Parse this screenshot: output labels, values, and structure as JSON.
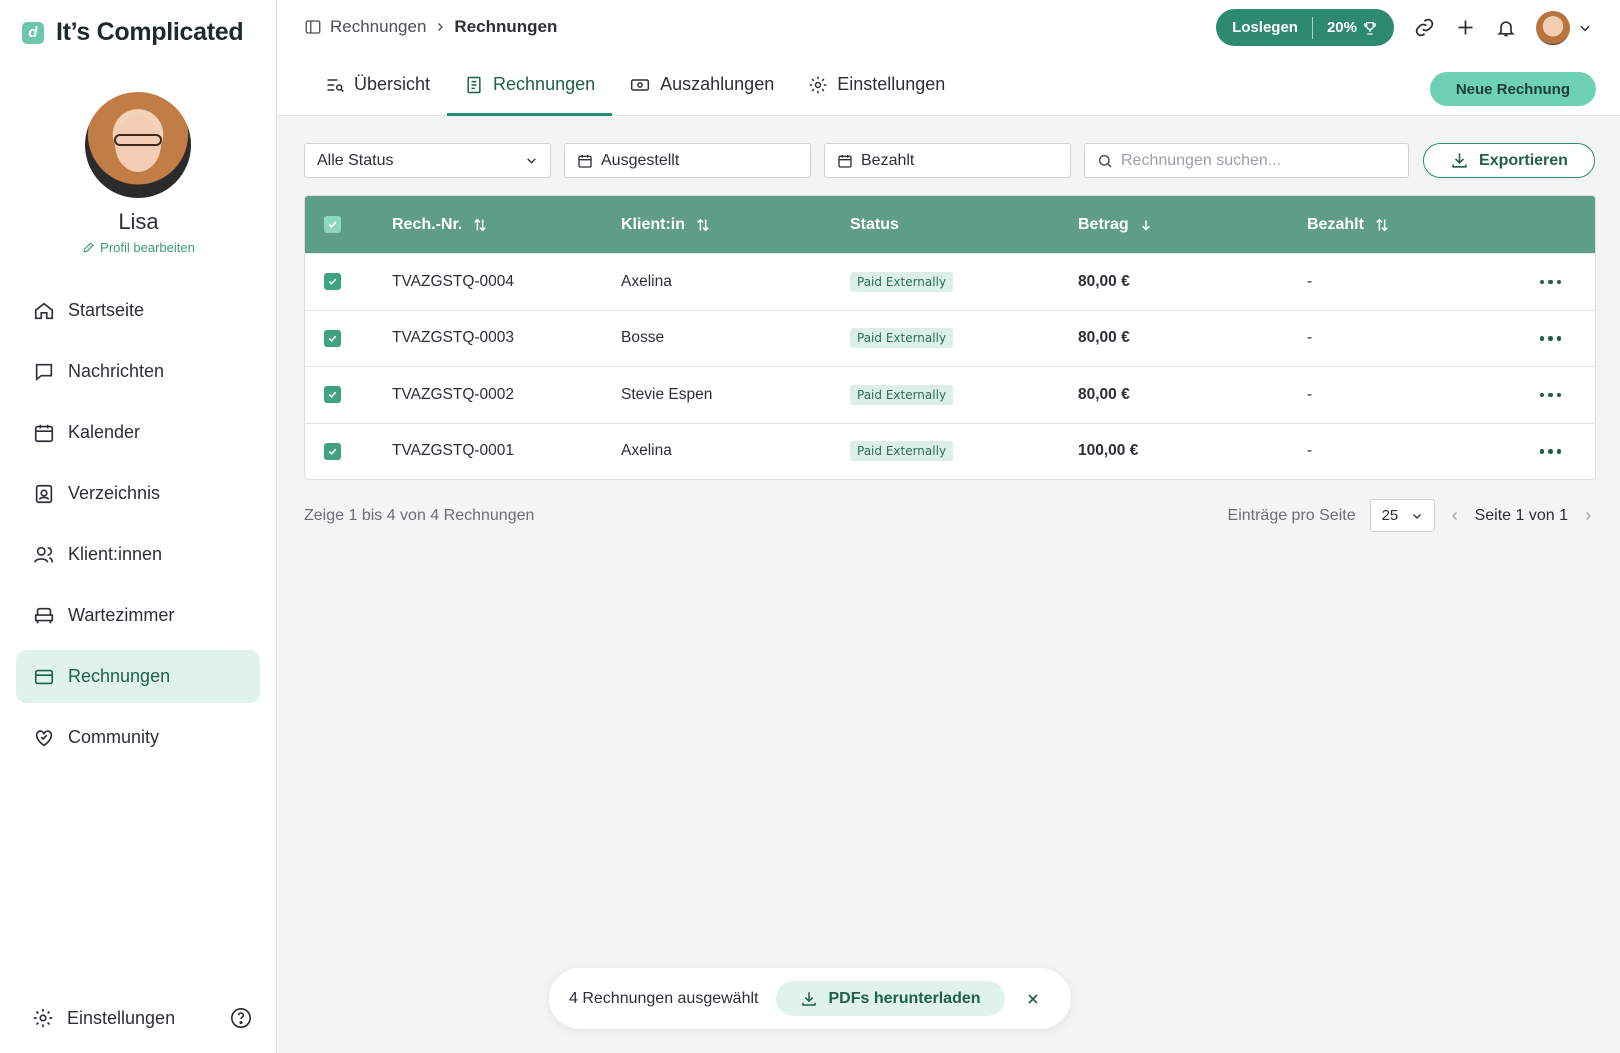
{
  "app": {
    "name": "It’s Complicated",
    "logo_letter": "d"
  },
  "profile": {
    "name": "Lisa",
    "edit_label": "Profil bearbeiten"
  },
  "sidebar": {
    "items": [
      {
        "label": "Startseite",
        "icon": "home-icon"
      },
      {
        "label": "Nachrichten",
        "icon": "message-icon"
      },
      {
        "label": "Kalender",
        "icon": "calendar-icon"
      },
      {
        "label": "Verzeichnis",
        "icon": "directory-icon"
      },
      {
        "label": "Klient:innen",
        "icon": "users-icon"
      },
      {
        "label": "Wartezimmer",
        "icon": "waiting-room-icon"
      },
      {
        "label": "Rechnungen",
        "icon": "invoice-card-icon",
        "active": true
      },
      {
        "label": "Community",
        "icon": "heart-handshake-icon"
      }
    ],
    "footer_settings": "Einstellungen"
  },
  "breadcrumb": {
    "parent": "Rechnungen",
    "current": "Rechnungen"
  },
  "topbar": {
    "start_label": "Loslegen",
    "progress": "20%"
  },
  "tabs": [
    {
      "label": "Übersicht",
      "icon": "overview-icon"
    },
    {
      "label": "Rechnungen",
      "icon": "document-icon",
      "active": true
    },
    {
      "label": "Auszahlungen",
      "icon": "cash-icon"
    },
    {
      "label": "Einstellungen",
      "icon": "gear-icon"
    }
  ],
  "new_invoice_label": "Neue Rechnung",
  "filters": {
    "status": "Alle Status",
    "issued": "Ausgestellt",
    "paid": "Bezahlt",
    "search_placeholder": "Rechnungen suchen...",
    "export": "Exportieren"
  },
  "table": {
    "columns": [
      "Rech.-Nr.",
      "Klient:in",
      "Status",
      "Betrag",
      "Bezahlt"
    ],
    "rows": [
      {
        "nr": "TVAZGSTQ-0004",
        "client": "Axelina",
        "status": "Paid Externally",
        "amount": "80,00 €",
        "paid": "-"
      },
      {
        "nr": "TVAZGSTQ-0003",
        "client": "Bosse",
        "status": "Paid Externally",
        "amount": "80,00 €",
        "paid": "-"
      },
      {
        "nr": "TVAZGSTQ-0002",
        "client": "Stevie Espen",
        "status": "Paid Externally",
        "amount": "80,00 €",
        "paid": "-"
      },
      {
        "nr": "TVAZGSTQ-0001",
        "client": "Axelina",
        "status": "Paid Externally",
        "amount": "100,00 €",
        "paid": "-"
      }
    ]
  },
  "pagination": {
    "summary": "Zeige 1 bis 4 von 4 Rechnungen",
    "per_page_label": "Einträge pro Seite",
    "per_page_value": "25",
    "page_label": "Seite 1 von 1"
  },
  "selection": {
    "count_label": "4 Rechnungen ausgewählt",
    "download_label": "PDFs herunterladen"
  },
  "colors": {
    "accent": "#2e8a6e",
    "header": "#5e9e89",
    "active_bg": "#dff3ec",
    "button": "#6fd1b4"
  }
}
